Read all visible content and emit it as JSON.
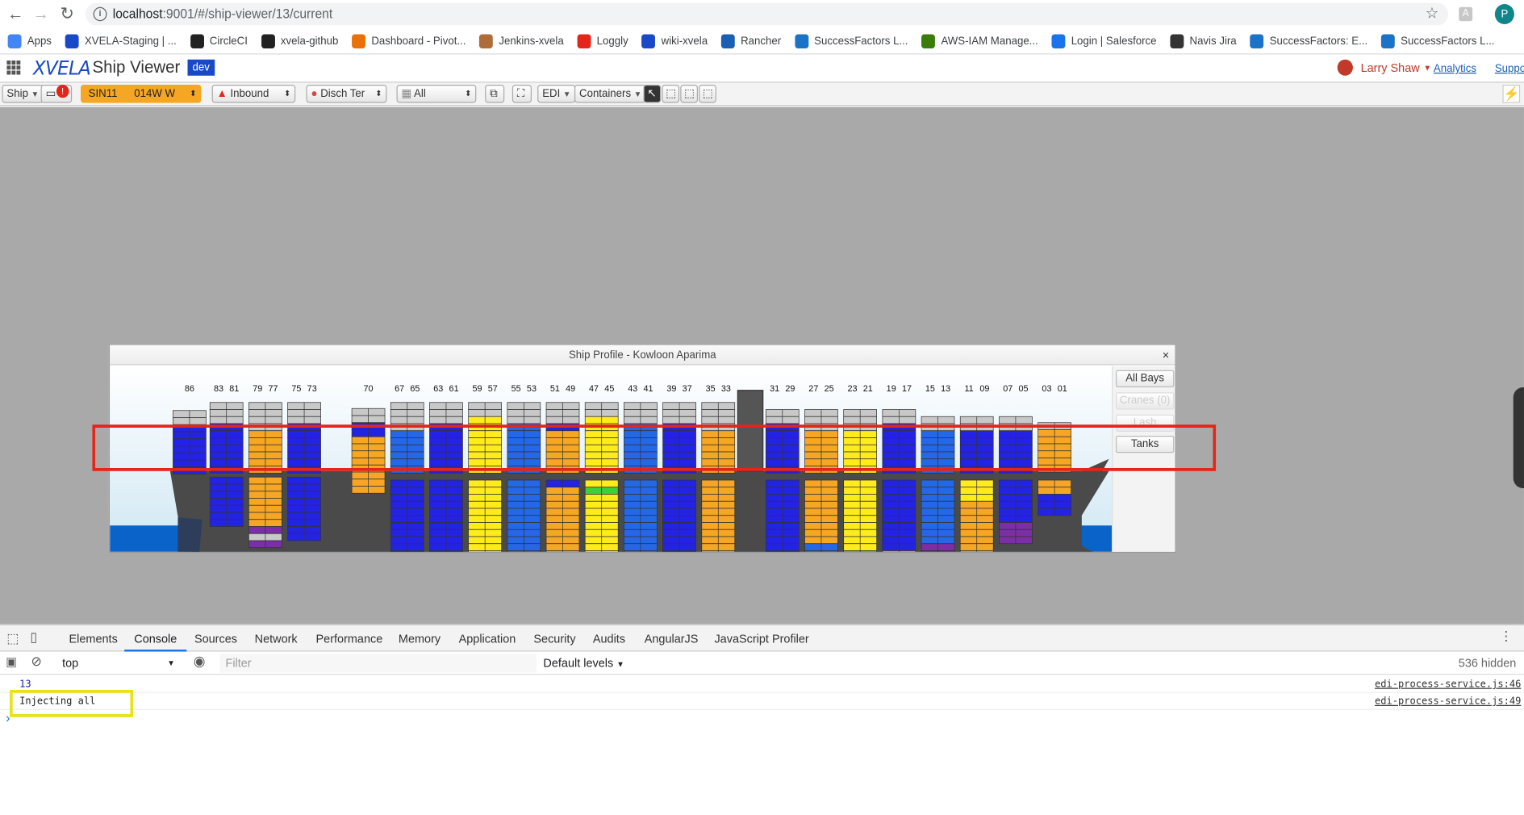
{
  "browser": {
    "url_host": "localhost",
    "url_path": ":9001/#/ship-viewer/13/current",
    "profile_initial": "P",
    "ext_label": "A",
    "bookmarks": [
      "Apps",
      "XVELA-Staging | ...",
      "CircleCI",
      "xvela-github",
      "Dashboard - Pivot...",
      "Jenkins-xvela",
      "Loggly",
      "wiki-xvela",
      "Rancher",
      "SuccessFactors L...",
      "AWS-IAM Manage...",
      "Login | Salesforce",
      "Navis Jira",
      "SuccessFactors: E...",
      "SuccessFactors L..."
    ]
  },
  "app": {
    "logo": "XVELA",
    "title": "Ship Viewer",
    "env": "dev",
    "user": "Larry Shaw",
    "analytics": "Analytics",
    "support": "Suppo"
  },
  "toolbar": {
    "ship": "Ship",
    "notif_count": "!",
    "port": "SIN11",
    "voyage": "014W W",
    "direction": "Inbound",
    "disch": "Disch Ter",
    "filter_all": "All",
    "edi": "EDI",
    "containers": "Containers"
  },
  "panel": {
    "title": "Ship Profile - Kowloon Aparima",
    "close": "×",
    "buttons": {
      "all_bays": "All Bays",
      "cranes": "Cranes (0)",
      "lash": "Lash",
      "tanks": "Tanks"
    }
  },
  "chart_data": {
    "type": "stowage-profile",
    "bay_groups": [
      {
        "labels": [
          "86"
        ]
      },
      {
        "labels": [
          "83",
          "81"
        ]
      },
      {
        "labels": [
          "79",
          "77"
        ]
      },
      {
        "labels": [
          "75",
          "73"
        ]
      },
      {
        "labels": [
          "70"
        ]
      },
      {
        "labels": [
          "67",
          "65"
        ]
      },
      {
        "labels": [
          "63",
          "61"
        ]
      },
      {
        "labels": [
          "59",
          "57"
        ]
      },
      {
        "labels": [
          "55",
          "53"
        ]
      },
      {
        "labels": [
          "51",
          "49"
        ]
      },
      {
        "labels": [
          "47",
          "45"
        ]
      },
      {
        "labels": [
          "43",
          "41"
        ]
      },
      {
        "labels": [
          "39",
          "37"
        ]
      },
      {
        "labels": [
          "35",
          "33"
        ]
      },
      {
        "labels": [
          "31",
          "29"
        ]
      },
      {
        "labels": [
          "27",
          "25"
        ]
      },
      {
        "labels": [
          "23",
          "21"
        ]
      },
      {
        "labels": [
          "19",
          "17"
        ]
      },
      {
        "labels": [
          "15",
          "13"
        ]
      },
      {
        "labels": [
          "11",
          "09"
        ]
      },
      {
        "labels": [
          "07",
          "05"
        ]
      },
      {
        "labels": [
          "03",
          "01"
        ]
      }
    ],
    "colors": {
      "blue": "#2323e6",
      "mblue": "#2468e8",
      "orange": "#f5a623",
      "yellow": "#ffec1a",
      "grey": "#c8c8c8",
      "purple": "#7b2ea5",
      "green": "#3ad13a",
      "hull": "#4a4a4a"
    }
  },
  "devtools": {
    "tabs": [
      "Elements",
      "Console",
      "Sources",
      "Network",
      "Performance",
      "Memory",
      "Application",
      "Security",
      "Audits",
      "AngularJS",
      "JavaScript Profiler"
    ],
    "context": "top",
    "filter_placeholder": "Filter",
    "levels": "Default levels",
    "hidden": "536 hidden",
    "logs": [
      {
        "text": "13",
        "source": "edi-process-service.js:46"
      },
      {
        "text": "Injecting all",
        "source": "edi-process-service.js:49"
      }
    ],
    "prompt": "›"
  }
}
